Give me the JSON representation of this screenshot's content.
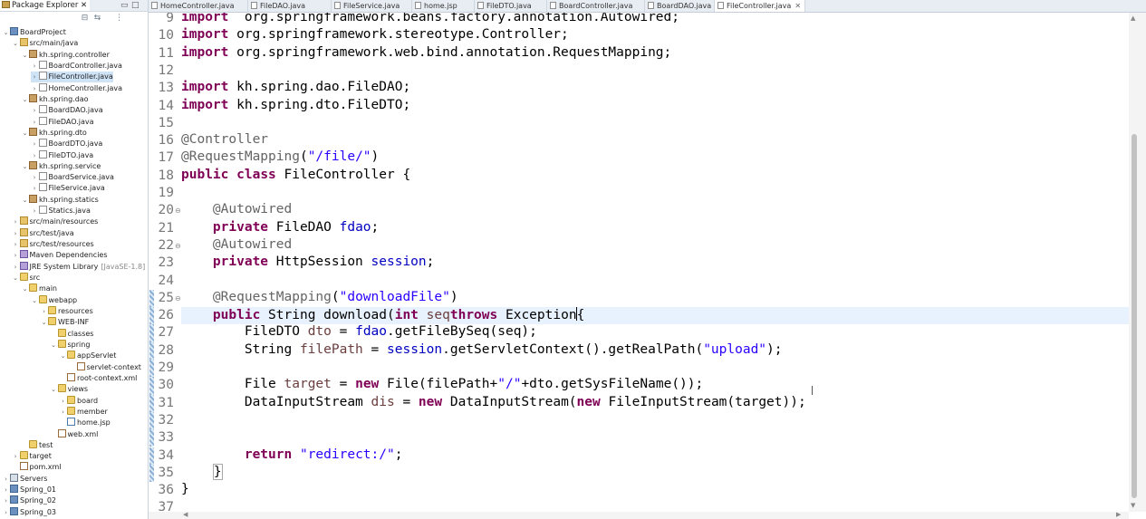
{
  "explorer": {
    "tab_label": "Package Explorer",
    "close_glyph": "✕",
    "minimize_glyph": "▭",
    "maximize_glyph": "□",
    "toolbar": {
      "collapse_glyph": "⊟",
      "link_glyph": "⇆",
      "menu_glyph": "⋮"
    },
    "tree": [
      {
        "label": "BoardProject",
        "indent": 0,
        "twisty": "⌄",
        "icon": "project"
      },
      {
        "label": "src/main/java",
        "indent": 1,
        "twisty": "⌄",
        "icon": "srcfolder"
      },
      {
        "label": "kh.spring.controller",
        "indent": 2,
        "twisty": "⌄",
        "icon": "package"
      },
      {
        "label": "BoardController.java",
        "indent": 3,
        "twisty": "›",
        "icon": "java"
      },
      {
        "label": "FileController.java",
        "indent": 3,
        "twisty": "›",
        "icon": "java",
        "selected": true
      },
      {
        "label": "HomeController.java",
        "indent": 3,
        "twisty": "›",
        "icon": "java"
      },
      {
        "label": "kh.spring.dao",
        "indent": 2,
        "twisty": "⌄",
        "icon": "package"
      },
      {
        "label": "BoardDAO.java",
        "indent": 3,
        "twisty": "›",
        "icon": "java"
      },
      {
        "label": "FileDAO.java",
        "indent": 3,
        "twisty": "›",
        "icon": "java"
      },
      {
        "label": "kh.spring.dto",
        "indent": 2,
        "twisty": "⌄",
        "icon": "package"
      },
      {
        "label": "BoardDTO.java",
        "indent": 3,
        "twisty": "›",
        "icon": "java"
      },
      {
        "label": "FileDTO.java",
        "indent": 3,
        "twisty": "›",
        "icon": "java"
      },
      {
        "label": "kh.spring.service",
        "indent": 2,
        "twisty": "⌄",
        "icon": "package"
      },
      {
        "label": "BoardService.java",
        "indent": 3,
        "twisty": "›",
        "icon": "java"
      },
      {
        "label": "FileService.java",
        "indent": 3,
        "twisty": "›",
        "icon": "java"
      },
      {
        "label": "kh.spring.statics",
        "indent": 2,
        "twisty": "⌄",
        "icon": "package"
      },
      {
        "label": "Statics.java",
        "indent": 3,
        "twisty": "›",
        "icon": "java"
      },
      {
        "label": "src/main/resources",
        "indent": 1,
        "twisty": "›",
        "icon": "srcfolder"
      },
      {
        "label": "src/test/java",
        "indent": 1,
        "twisty": "›",
        "icon": "srcfolder"
      },
      {
        "label": "src/test/resources",
        "indent": 1,
        "twisty": "›",
        "icon": "srcfolder"
      },
      {
        "label": "Maven Dependencies",
        "indent": 1,
        "twisty": "›",
        "icon": "lib"
      },
      {
        "label": "JRE System Library",
        "suffix": "[JavaSE-1.8]",
        "indent": 1,
        "twisty": "›",
        "icon": "lib"
      },
      {
        "label": "src",
        "indent": 1,
        "twisty": "⌄",
        "icon": "folder"
      },
      {
        "label": "main",
        "indent": 2,
        "twisty": "⌄",
        "icon": "folder"
      },
      {
        "label": "webapp",
        "indent": 3,
        "twisty": "⌄",
        "icon": "folder"
      },
      {
        "label": "resources",
        "indent": 4,
        "twisty": "›",
        "icon": "folder"
      },
      {
        "label": "WEB-INF",
        "indent": 4,
        "twisty": "⌄",
        "icon": "folder"
      },
      {
        "label": "classes",
        "indent": 5,
        "twisty": "",
        "icon": "folder"
      },
      {
        "label": "spring",
        "indent": 5,
        "twisty": "⌄",
        "icon": "folder"
      },
      {
        "label": "appServlet",
        "indent": 6,
        "twisty": "⌄",
        "icon": "folder"
      },
      {
        "label": "servlet-context",
        "indent": 7,
        "twisty": "",
        "icon": "xml"
      },
      {
        "label": "root-context.xml",
        "indent": 6,
        "twisty": "",
        "icon": "xml"
      },
      {
        "label": "views",
        "indent": 5,
        "twisty": "⌄",
        "icon": "folder"
      },
      {
        "label": "board",
        "indent": 6,
        "twisty": "›",
        "icon": "folder"
      },
      {
        "label": "member",
        "indent": 6,
        "twisty": "›",
        "icon": "folder"
      },
      {
        "label": "home.jsp",
        "indent": 6,
        "twisty": "",
        "icon": "jsp"
      },
      {
        "label": "web.xml",
        "indent": 5,
        "twisty": "",
        "icon": "xml"
      },
      {
        "label": "test",
        "indent": 2,
        "twisty": "",
        "icon": "folder"
      },
      {
        "label": "target",
        "indent": 1,
        "twisty": "›",
        "icon": "folder"
      },
      {
        "label": "pom.xml",
        "indent": 1,
        "twisty": "",
        "icon": "xml"
      },
      {
        "label": "Servers",
        "indent": 0,
        "twisty": "›",
        "icon": "server"
      },
      {
        "label": "Spring_01",
        "indent": 0,
        "twisty": "›",
        "icon": "project"
      },
      {
        "label": "Spring_02",
        "indent": 0,
        "twisty": "›",
        "icon": "project"
      },
      {
        "label": "Spring_03",
        "indent": 0,
        "twisty": "›",
        "icon": "project"
      }
    ]
  },
  "editor": {
    "tabs": [
      {
        "label": "HomeController.java"
      },
      {
        "label": "FileDAO.java"
      },
      {
        "label": "FileService.java"
      },
      {
        "label": "home.jsp"
      },
      {
        "label": "FileDTO.java"
      },
      {
        "label": "BoardController.java"
      },
      {
        "label": "BoardDAO.java"
      },
      {
        "label": "FileController.java",
        "active": true,
        "close": "✕"
      }
    ],
    "lines": [
      {
        "n": "9",
        "tokens": [
          [
            "kw",
            "import"
          ],
          [
            "",
            "  org.springframework.beans.factory.annotation.Autowired;"
          ]
        ]
      },
      {
        "n": "10",
        "tokens": [
          [
            "kw",
            "import"
          ],
          [
            "",
            " org.springframework.stereotype.Controller;"
          ]
        ]
      },
      {
        "n": "11",
        "tokens": [
          [
            "kw",
            "import"
          ],
          [
            "",
            " org.springframework.web.bind.annotation.RequestMapping;"
          ]
        ]
      },
      {
        "n": "12",
        "tokens": []
      },
      {
        "n": "13",
        "tokens": [
          [
            "kw",
            "import"
          ],
          [
            "",
            " kh.spring.dao.FileDAO;"
          ]
        ]
      },
      {
        "n": "14",
        "tokens": [
          [
            "kw",
            "import"
          ],
          [
            "",
            " kh.spring.dto.FileDTO;"
          ]
        ]
      },
      {
        "n": "15",
        "tokens": []
      },
      {
        "n": "16",
        "tokens": [
          [
            "ann",
            "@Controller"
          ]
        ]
      },
      {
        "n": "17",
        "tokens": [
          [
            "ann",
            "@RequestMapping"
          ],
          [
            "",
            "("
          ],
          [
            "str",
            "\"/file/\""
          ],
          [
            "",
            ")"
          ]
        ]
      },
      {
        "n": "18",
        "tokens": [
          [
            "kw",
            "public"
          ],
          [
            "",
            " "
          ],
          [
            "kw",
            "class"
          ],
          [
            "",
            " FileController {"
          ]
        ]
      },
      {
        "n": "19",
        "tokens": []
      },
      {
        "n": "20",
        "fold": "⊖",
        "tokens": [
          [
            "",
            "    "
          ],
          [
            "ann",
            "@Autowired"
          ]
        ]
      },
      {
        "n": "21",
        "tokens": [
          [
            "",
            "    "
          ],
          [
            "kw",
            "private"
          ],
          [
            "",
            " FileDAO "
          ],
          [
            "fld",
            "fdao"
          ],
          [
            "",
            ";"
          ]
        ]
      },
      {
        "n": "22",
        "fold": "⊖",
        "tokens": [
          [
            "",
            "    "
          ],
          [
            "ann",
            "@Autowired"
          ]
        ]
      },
      {
        "n": "23",
        "tokens": [
          [
            "",
            "    "
          ],
          [
            "kw",
            "private"
          ],
          [
            "",
            " HttpSession "
          ],
          [
            "fld",
            "session"
          ],
          [
            "",
            ";"
          ]
        ]
      },
      {
        "n": "24",
        "tokens": []
      },
      {
        "n": "25",
        "fold": "⊖",
        "annot": true,
        "tokens": [
          [
            "",
            "    "
          ],
          [
            "ann",
            "@RequestMapping"
          ],
          [
            "",
            "("
          ],
          [
            "str",
            "\"downloadFile\""
          ],
          [
            "",
            ")"
          ]
        ]
      },
      {
        "n": "26",
        "current": true,
        "annot": true,
        "tokens": [
          [
            "",
            "    "
          ],
          [
            "kw",
            "public"
          ],
          [
            "",
            " String download("
          ],
          [
            "kw",
            "int"
          ],
          [
            "",
            " "
          ],
          [
            "lv",
            "seq"
          ],
          [
            ") "
          ],
          [
            "kw",
            "throws"
          ],
          [
            "",
            " Exception"
          ],
          [
            "caret",
            ""
          ],
          [
            "",
            "{"
          ]
        ]
      },
      {
        "n": "27",
        "annot": true,
        "tokens": [
          [
            "",
            "        FileDTO "
          ],
          [
            "lv",
            "dto"
          ],
          [
            "",
            " = "
          ],
          [
            "fld",
            "fdao"
          ],
          [
            "",
            ".getFileBySeq(seq);"
          ]
        ]
      },
      {
        "n": "28",
        "annot": true,
        "tokens": [
          [
            "",
            "        String "
          ],
          [
            "lv",
            "filePath"
          ],
          [
            "",
            " = "
          ],
          [
            "fld",
            "session"
          ],
          [
            "",
            ".getServletContext().getRealPath("
          ],
          [
            "str",
            "\"upload\""
          ],
          [
            "",
            ");"
          ]
        ]
      },
      {
        "n": "29",
        "annot": true,
        "tokens": []
      },
      {
        "n": "30",
        "annot": true,
        "tokens": [
          [
            "",
            "        File "
          ],
          [
            "lv",
            "target"
          ],
          [
            "",
            " = "
          ],
          [
            "kw",
            "new"
          ],
          [
            "",
            " File(filePath+"
          ],
          [
            "str",
            "\"/\""
          ],
          [
            "",
            "+dto.getSysFileName());"
          ]
        ]
      },
      {
        "n": "31",
        "annot": true,
        "tokens": [
          [
            "",
            "        DataInputStream "
          ],
          [
            "lv",
            "dis"
          ],
          [
            "",
            " = "
          ],
          [
            "kw",
            "new"
          ],
          [
            "",
            " DataInputStream("
          ],
          [
            "kw",
            "new"
          ],
          [
            "",
            " FileInputStream(target));"
          ]
        ]
      },
      {
        "n": "32",
        "annot": true,
        "tokens": []
      },
      {
        "n": "33",
        "annot": true,
        "tokens": []
      },
      {
        "n": "34",
        "annot": true,
        "tokens": [
          [
            "",
            "        "
          ],
          [
            "kw",
            "return"
          ],
          [
            "",
            " "
          ],
          [
            "str",
            "\"redirect:/\""
          ],
          [
            "",
            ";"
          ]
        ]
      },
      {
        "n": "35",
        "annot": true,
        "tokens": [
          [
            "",
            "    "
          ],
          [
            "brace",
            "}"
          ]
        ]
      },
      {
        "n": "36",
        "tokens": [
          [
            "",
            "}"
          ]
        ]
      },
      {
        "n": "37",
        "tokens": []
      }
    ]
  }
}
